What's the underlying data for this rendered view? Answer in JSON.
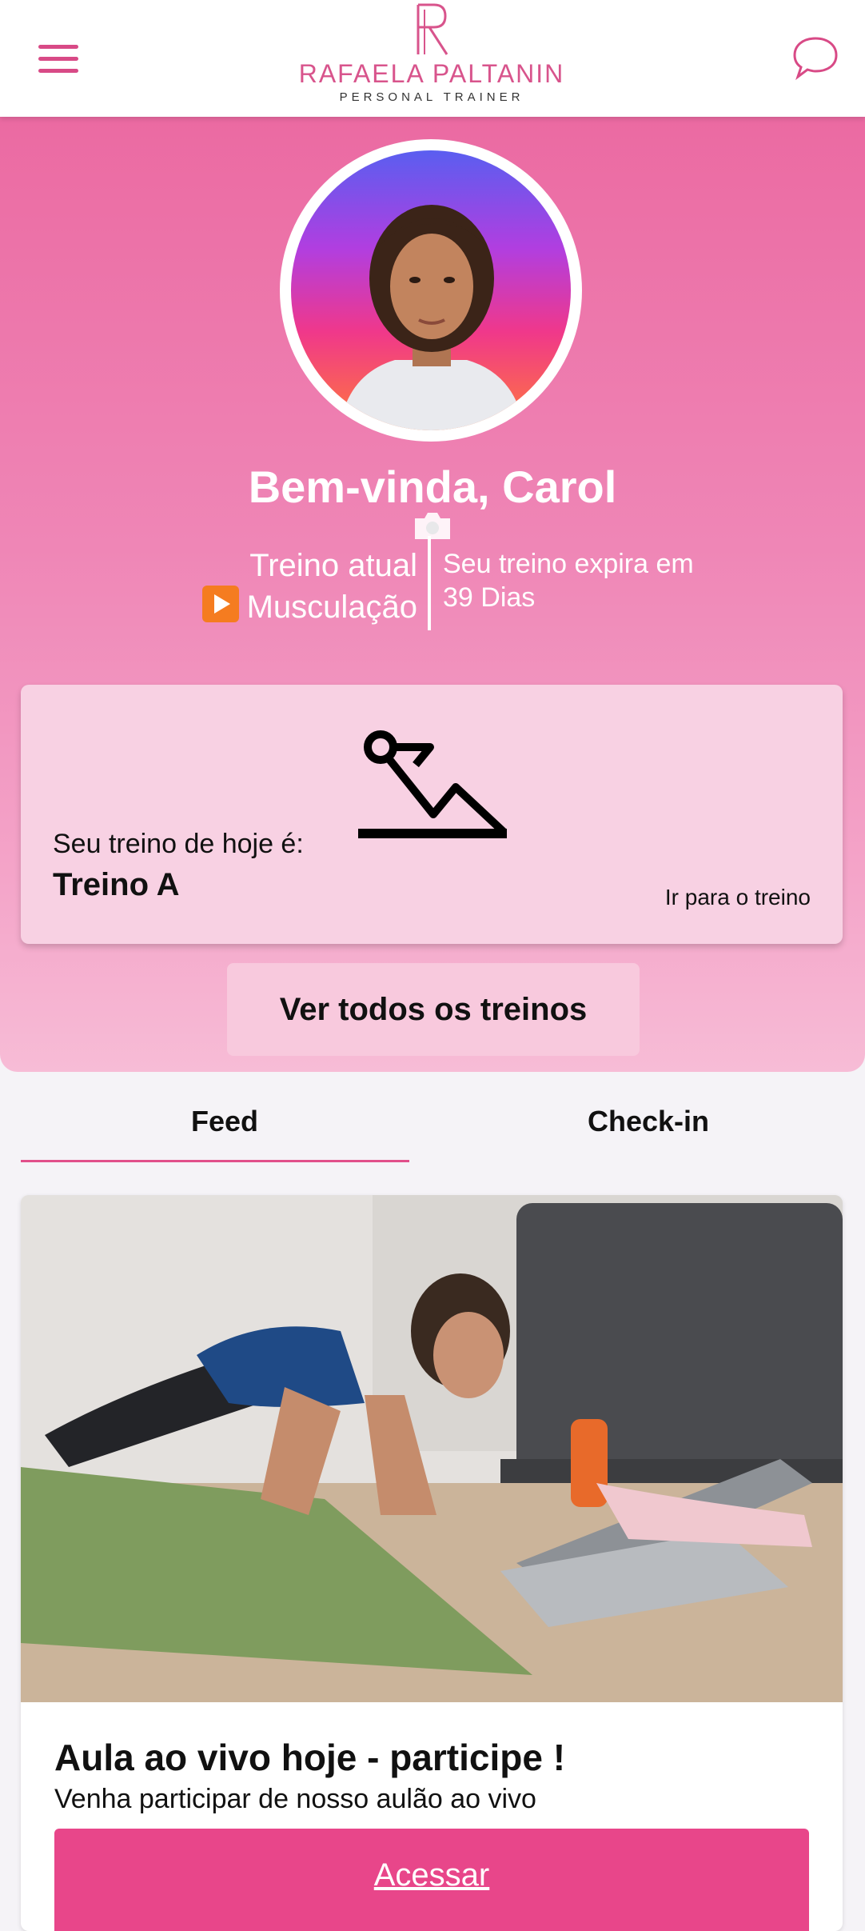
{
  "header": {
    "brand_name": "RAFAELA PALTANIN",
    "brand_sub": "PERSONAL TRAINER",
    "menu_icon": "hamburger-icon",
    "chat_icon": "chat-bubble-icon",
    "brand_color": "#d84a86"
  },
  "profile": {
    "welcome": "Bem-vinda, Carol",
    "current_label": "Treino atual",
    "current_value": "Musculação",
    "expire_label": "Seu treino expira em",
    "expire_value": "39 Dias"
  },
  "today": {
    "label": "Seu treino de hoje é:",
    "name": "Treino A",
    "link": "Ir para o treino"
  },
  "all_workouts_button": "Ver todos os treinos",
  "tabs": [
    {
      "label": "Feed",
      "active": true
    },
    {
      "label": "Check-in",
      "active": false
    }
  ],
  "post": {
    "title": "Aula ao vivo hoje - participe !",
    "description": "Venha participar de nosso aulão ao vivo",
    "button": "Acessar"
  },
  "colors": {
    "accent": "#e8468a",
    "hero_top": "#eb6aa2",
    "hero_bottom": "#f7bcd6",
    "card": "#f8d1e3"
  }
}
